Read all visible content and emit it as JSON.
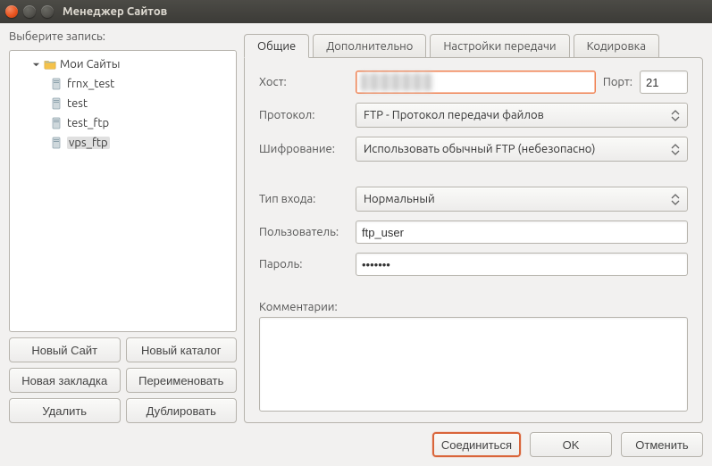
{
  "window": {
    "title": "Менеджер Сайтов"
  },
  "left": {
    "prompt": "Выберите запись:",
    "root_label": "Мои Сайты",
    "sites": [
      {
        "name": "frnx_test"
      },
      {
        "name": "test"
      },
      {
        "name": "test_ftp"
      },
      {
        "name": "vps_ftp"
      }
    ],
    "selected_index": 3,
    "buttons": {
      "new_site": "Новый Сайт",
      "new_folder": "Новый каталог",
      "new_bookmark": "Новая закладка",
      "rename": "Переименовать",
      "delete": "Удалить",
      "duplicate": "Дублировать"
    }
  },
  "tabs": {
    "general": "Общие",
    "advanced": "Дополнительно",
    "transfer": "Настройки передачи",
    "charset": "Кодировка",
    "active": "general"
  },
  "form": {
    "host_label": "Хост:",
    "host_value": "",
    "port_label": "Порт:",
    "port_value": "21",
    "protocol_label": "Протокол:",
    "protocol_value": "FTP - Протокол передачи файлов",
    "encryption_label": "Шифрование:",
    "encryption_value": "Использовать обычный FTP (небезопасно)",
    "logon_label": "Тип входа:",
    "logon_value": "Нормальный",
    "user_label": "Пользователь:",
    "user_value": "ftp_user",
    "password_label": "Пароль:",
    "password_value": "•••••••",
    "comments_label": "Комментарии:",
    "comments_value": ""
  },
  "footer": {
    "connect": "Соединиться",
    "ok": "OK",
    "cancel": "Отменить"
  }
}
